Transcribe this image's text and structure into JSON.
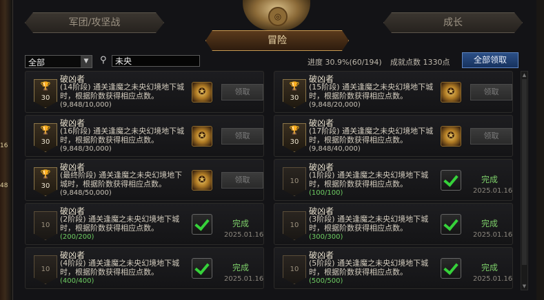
{
  "tabs": {
    "left": "军团/攻坚战",
    "center": "冒险",
    "right": "成长"
  },
  "filter": {
    "selected": "全部",
    "search_value": "未央"
  },
  "stats": {
    "progress": "进度 30.9%(60/194)",
    "points": "成就点数 1330点"
  },
  "claim_all_label": "全部领取",
  "left_edge_marks": [
    "16",
    "48"
  ],
  "cards": [
    {
      "title": "破凶者",
      "desc": "(14阶段) 通关逢魔之未央幻境地下城时，根据阶数获得相应点数。",
      "progress": "(9,848/10,000)",
      "points": "30",
      "status": "claim",
      "button": "领取",
      "date": ""
    },
    {
      "title": "破凶者",
      "desc": "(15阶段) 通关逢魔之未央幻境地下城时，根据阶数获得相应点数。",
      "progress": "(9,848/20,000)",
      "points": "30",
      "status": "claim",
      "button": "领取",
      "date": ""
    },
    {
      "title": "破凶者",
      "desc": "(16阶段) 通关逢魔之未央幻境地下城时，根据阶数获得相应点数。",
      "progress": "(9,848/30,000)",
      "points": "30",
      "status": "claim",
      "button": "领取",
      "date": ""
    },
    {
      "title": "破凶者",
      "desc": "(17阶段) 通关逢魔之未央幻境地下城时，根据阶数获得相应点数。",
      "progress": "(9,848/40,000)",
      "points": "30",
      "status": "claim",
      "button": "领取",
      "date": ""
    },
    {
      "title": "破凶者",
      "desc": "(最终阶段) 通关逢魔之未央幻境地下城时，根据阶数获得相应点数。",
      "progress": "(9,848/50,000)",
      "points": "30",
      "status": "claim",
      "button": "领取",
      "date": ""
    },
    {
      "title": "破凶者",
      "desc": "(1阶段) 通关逢魔之未央幻境地下城时，根据阶数获得相应点数。",
      "progress": "(100/100)",
      "points": "10",
      "status": "done",
      "button": "完成",
      "date": "2025.01.16"
    },
    {
      "title": "破凶者",
      "desc": "(2阶段) 通关逢魔之未央幻境地下城时，根据阶数获得相应点数。",
      "progress": "(200/200)",
      "points": "10",
      "status": "done",
      "button": "完成",
      "date": "2025.01.16"
    },
    {
      "title": "破凶者",
      "desc": "(3阶段) 通关逢魔之未央幻境地下城时，根据阶数获得相应点数。",
      "progress": "(300/300)",
      "points": "10",
      "status": "done",
      "button": "完成",
      "date": "2025.01.16"
    },
    {
      "title": "破凶者",
      "desc": "(4阶段) 通关逢魔之未央幻境地下城时，根据阶数获得相应点数。",
      "progress": "(400/400)",
      "points": "10",
      "status": "done",
      "button": "完成",
      "date": "2025.01.16"
    },
    {
      "title": "破凶者",
      "desc": "(5阶段) 通关逢魔之未央幻境地下城时，根据阶数获得相应点数。",
      "progress": "(500/500)",
      "points": "10",
      "status": "done",
      "button": "完成",
      "date": "2025.01.16"
    }
  ]
}
